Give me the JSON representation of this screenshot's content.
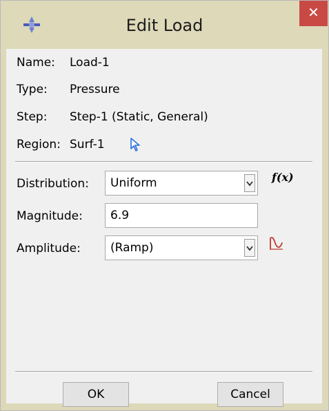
{
  "window": {
    "title": "Edit Load",
    "close_symbol": "✕",
    "icon": "abaqus-compass-icon"
  },
  "info": {
    "name_label": "Name:",
    "name_value": "Load-1",
    "type_label": "Type:",
    "type_value": "Pressure",
    "step_label": "Step:",
    "step_value": "Step-1 (Static, General)",
    "region_label": "Region:",
    "region_value": "Surf-1",
    "region_icon": "select-pointer-icon"
  },
  "form": {
    "distribution_label": "Distribution:",
    "distribution_value": "Uniform",
    "fx_label": "f(x)",
    "magnitude_label": "Magnitude:",
    "magnitude_value": "6.9",
    "amplitude_label": "Amplitude:",
    "amplitude_value": "(Ramp)",
    "amplitude_icon": "amplitude-curve-icon"
  },
  "buttons": {
    "ok_label": "OK",
    "cancel_label": "Cancel"
  },
  "colors": {
    "close_button": "#c94a45",
    "title_bar": "#ddd9b9",
    "dialog_background": "#f0f0f0",
    "pointer_icon": "#2b6fdc",
    "amplitude_icon": "#c0392b"
  }
}
